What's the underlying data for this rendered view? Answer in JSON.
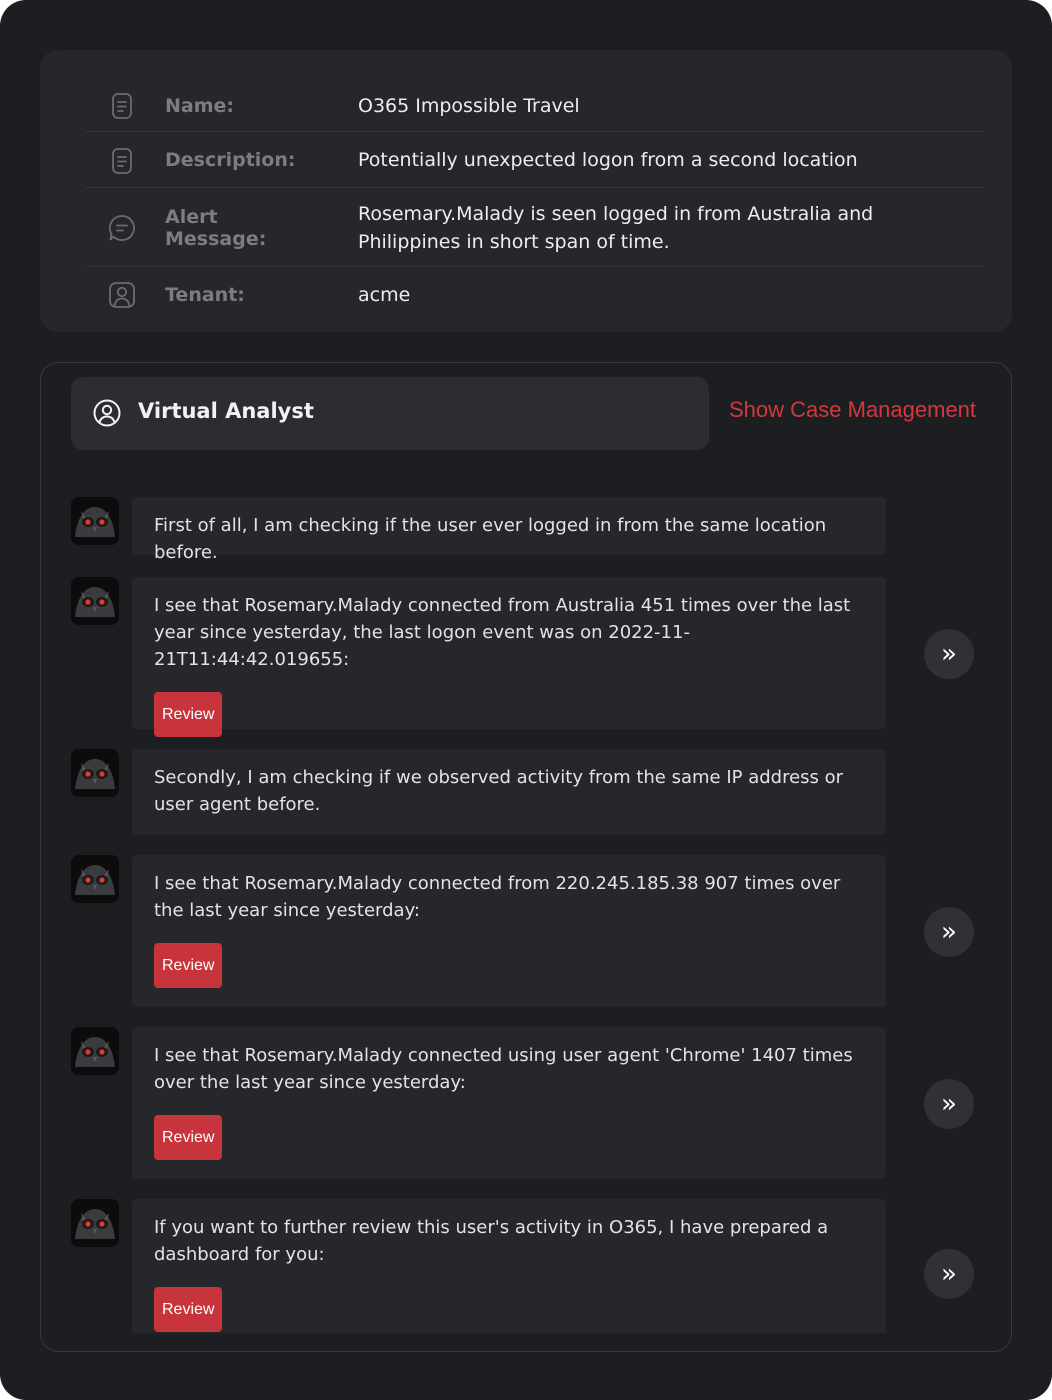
{
  "details": {
    "rows": [
      {
        "label": "Name:",
        "value": "O365 Impossible Travel",
        "icon": "document-icon"
      },
      {
        "label": "Description:",
        "value": "Potentially unexpected logon from a second location",
        "icon": "document-icon"
      },
      {
        "label": "Alert Message:",
        "value": "Rosemary.Malady is seen logged in from Australia and Philippines in short span of time.",
        "icon": "message-icon"
      },
      {
        "label": "Tenant:",
        "value": "acme",
        "icon": "user-icon"
      }
    ]
  },
  "analyst": {
    "title": "Virtual Analyst",
    "case_link": "Show Case Management",
    "messages": [
      {
        "text": "First of all, I am checking if the user ever logged in from the same location before.",
        "review": null,
        "expand": null
      },
      {
        "text": "I see that Rosemary.Malady connected from Australia 451 times over the last year since yesterday, the last logon event was on 2022-11-21T11:44:42.019655:",
        "review": "Review",
        "expand": "»"
      },
      {
        "text": "Secondly, I am checking if we observed activity from the same IP address or user agent before.",
        "review": null,
        "expand": null
      },
      {
        "text": "I see that Rosemary.Malady connected from 220.245.185.38 907 times over the last year since yesterday:",
        "review": "Review",
        "expand": "»"
      },
      {
        "text": "I see that Rosemary.Malady connected using user agent 'Chrome' 1407 times over the last year since yesterday:",
        "review": "Review",
        "expand": "»"
      },
      {
        "text": "If you want to further review this user's activity in O365, I have prepared a dashboard for you:",
        "review": "Review",
        "expand": "»"
      }
    ]
  },
  "colors": {
    "background": "#1d1e21",
    "card": "#26272b",
    "accent": "#d2393f",
    "button": "#c8343b"
  }
}
